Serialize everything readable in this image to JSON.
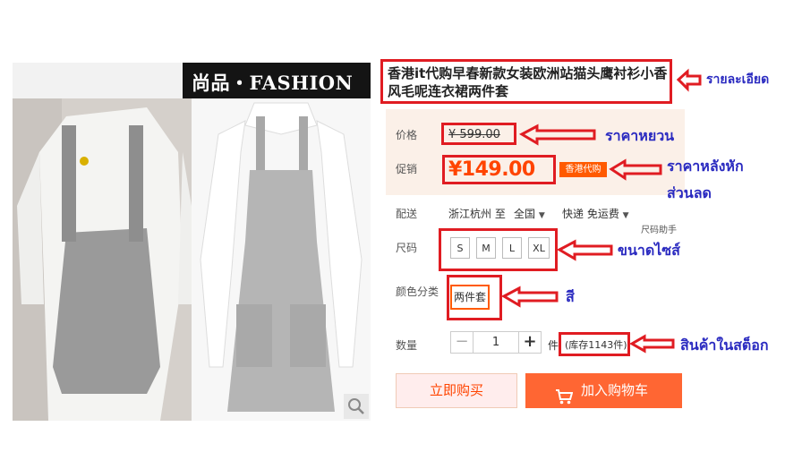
{
  "product": {
    "title": "香港it代购早春新款女装欧洲站猫头鹰衬衫小香风毛呢连衣裙两件套",
    "banner_text": "尚品・FASHION"
  },
  "price": {
    "label": "价格",
    "original": "¥ 599.00",
    "promo_label": "促销",
    "promo": "¥149.00",
    "promo_badge": "香港代购"
  },
  "shipping": {
    "label": "配送",
    "from": "浙江杭州 至",
    "to": "全国",
    "method": "快递 免运费"
  },
  "size": {
    "label": "尺码",
    "helper": "尺码助手",
    "options": [
      "S",
      "M",
      "L",
      "XL"
    ]
  },
  "color": {
    "label": "颜色分类",
    "option": "两件套"
  },
  "quantity": {
    "label": "数量",
    "value": "1",
    "unit": "件",
    "stock": "(库存1143件)",
    "minus": "−",
    "plus": "+"
  },
  "actions": {
    "buy_now": "立即购买",
    "add_to_cart": "加入购物车"
  },
  "annotations": {
    "details": "รายละเอียด",
    "original_price": "ราคาหยวน",
    "discount_price_line1": "ราคาหลังหัก",
    "discount_price_line2": "ส่วนลด",
    "size": "ขนาดไซส์",
    "color": "สี",
    "stock": "สินค้าในสต็อก"
  },
  "colors": {
    "annotation_red": "#e01c22",
    "annotation_blue": "#2a2ac0",
    "accent_orange": "#ff5a00",
    "price_red": "#ff4400"
  }
}
